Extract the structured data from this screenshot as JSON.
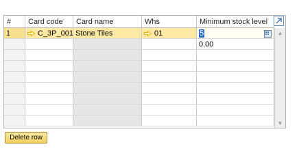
{
  "grid": {
    "columns": [
      "#",
      "Card code",
      "Card name",
      "Whs",
      "Minimum stock level"
    ],
    "rows": [
      {
        "num": "1",
        "card_code": "C_3P_001",
        "card_name": "Stone Tiles",
        "whs": "01",
        "min_stock": "5"
      }
    ],
    "new_row_min_stock": "0.00"
  },
  "icons": {
    "link_arrow": "link-arrow-icon",
    "calculator": "calculator-icon",
    "expand": "expand-icon",
    "scroll_up": "scroll-up-icon",
    "scroll_down": "scroll-down-icon"
  },
  "colors": {
    "selected_row": "#fde9a4",
    "button_gold": "#f1cf5f",
    "link_arrow": "#e3b400",
    "cursor": "#2f6ebd"
  },
  "actions": {
    "delete_row_label": "Delete row"
  }
}
